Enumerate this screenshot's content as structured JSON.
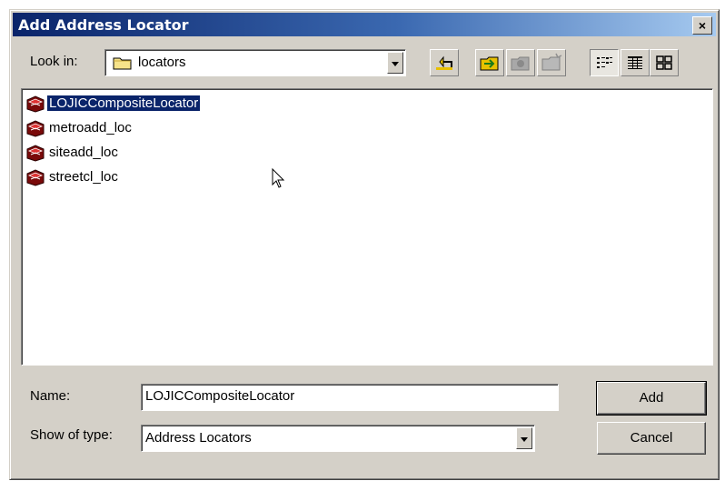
{
  "window": {
    "title": "Add Address Locator",
    "close_glyph": "×"
  },
  "lookin": {
    "label": "Look in:",
    "value": "locators",
    "icon": "folder-icon"
  },
  "toolbar": [
    {
      "name": "up-one-level-button",
      "icon": "up-folder-icon"
    },
    {
      "name": "connect-folder-button",
      "icon": "connect-folder-icon"
    },
    {
      "name": "disconnect-folder-button",
      "icon": "disconnect-folder-icon"
    },
    {
      "name": "new-folder-button",
      "icon": "new-folder-icon"
    },
    {
      "name": "list-view-button",
      "icon": "list-view-icon"
    },
    {
      "name": "details-view-button",
      "icon": "details-view-icon"
    },
    {
      "name": "thumbnails-view-button",
      "icon": "thumbnails-view-icon"
    }
  ],
  "files": [
    {
      "name": "LOJICCompositeLocator",
      "icon": "address-locator-icon",
      "selected": true
    },
    {
      "name": "metroadd_loc",
      "icon": "address-locator-icon"
    },
    {
      "name": "siteadd_loc",
      "icon": "address-locator-icon"
    },
    {
      "name": "streetcl_loc",
      "icon": "address-locator-icon"
    }
  ],
  "name_field": {
    "label": "Name:",
    "value": "LOJICCompositeLocator"
  },
  "type_field": {
    "label": "Show of type:",
    "value": "Address Locators"
  },
  "buttons": {
    "add": "Add",
    "cancel": "Cancel"
  },
  "colors": {
    "title_start": "#0a246a",
    "title_end": "#a6caf0",
    "selection": "#0a246a",
    "face": "#d4d0c8"
  }
}
